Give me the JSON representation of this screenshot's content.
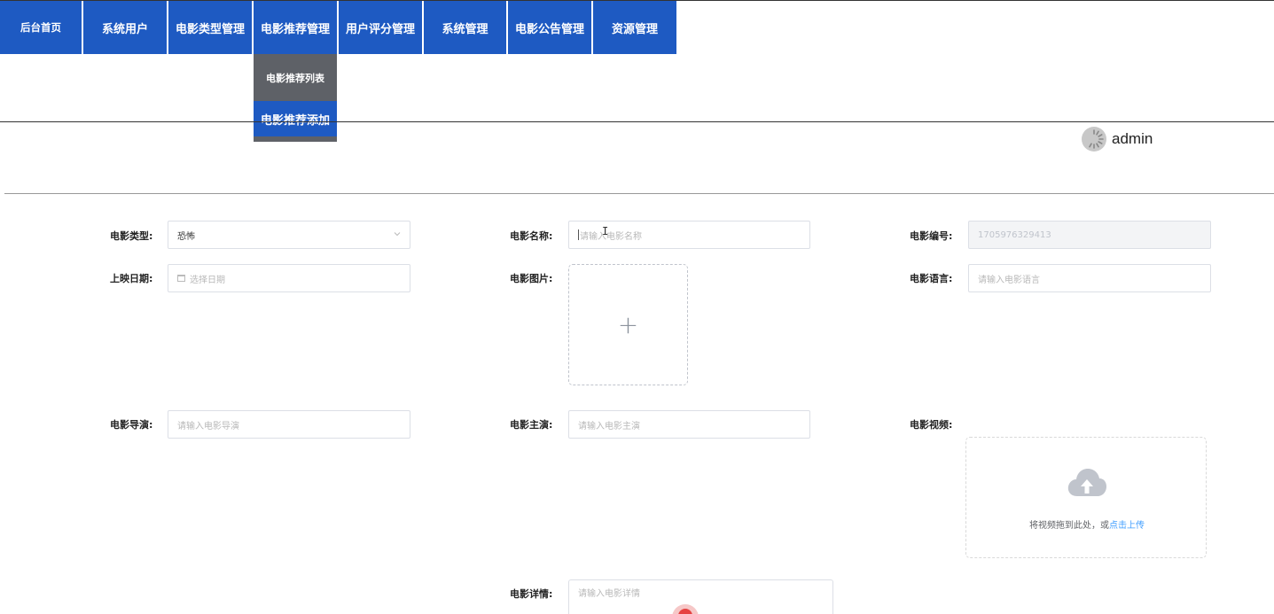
{
  "nav": {
    "items": [
      {
        "label": "后台首页"
      },
      {
        "label": "系统用户"
      },
      {
        "label": "电影类型管理"
      },
      {
        "label": "电影推荐管理"
      },
      {
        "label": "用户评分管理"
      },
      {
        "label": "系统管理"
      },
      {
        "label": "电影公告管理"
      },
      {
        "label": "资源管理"
      }
    ],
    "submenu": {
      "list": "电影推荐列表",
      "add": "电影推荐添加"
    }
  },
  "user": {
    "name": "admin"
  },
  "form": {
    "type": {
      "label": "电影类型:",
      "value": "恐怖"
    },
    "name": {
      "label": "电影名称:",
      "placeholder": "请输入电影名称"
    },
    "code": {
      "label": "电影编号:",
      "value": "1705976329413"
    },
    "date": {
      "label": "上映日期:",
      "placeholder": "选择日期"
    },
    "image": {
      "label": "电影图片:",
      "plus": "+"
    },
    "language": {
      "label": "电影语言:",
      "placeholder": "请输入电影语言"
    },
    "director": {
      "label": "电影导演:",
      "placeholder": "请输入电影导演"
    },
    "actor": {
      "label": "电影主演:",
      "placeholder": "请输入电影主演"
    },
    "video": {
      "label": "电影视频:",
      "drop_text": "将视频拖到此处，或",
      "click_text": "点击上传"
    },
    "detail": {
      "label": "电影详情:",
      "placeholder": "请输入电影详情"
    }
  },
  "colors": {
    "nav_bg": "#1e5ac2",
    "submenu_bg": "#5e6167",
    "link": "#409eff"
  }
}
